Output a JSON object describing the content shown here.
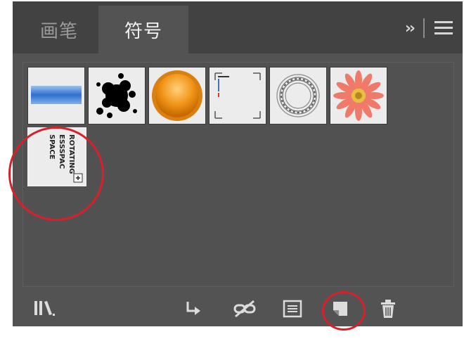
{
  "tabs": [
    {
      "label": "画笔",
      "active": false
    },
    {
      "label": "符号",
      "active": true
    }
  ],
  "header_icons": [
    "collapse-panel-icon",
    "panel-menu-icon"
  ],
  "symbols": [
    {
      "name": "blue-gradient-bar-symbol"
    },
    {
      "name": "ink-splat-symbol"
    },
    {
      "name": "orange-button-symbol"
    },
    {
      "name": "grid-corner-marks-symbol"
    },
    {
      "name": "ribbon-wreath-symbol"
    },
    {
      "name": "pink-flower-symbol"
    },
    {
      "name": "rotating-text-symbol",
      "lines": [
        "ROTATING",
        "ESSSPAC",
        "SPACE"
      ],
      "selected": true
    }
  ],
  "bottom_icons": [
    "symbol-libraries-icon",
    "place-symbol-instance-icon",
    "break-link-icon",
    "symbol-options-icon",
    "new-symbol-icon",
    "delete-symbol-icon"
  ],
  "colors": {
    "panel": "#535353",
    "tabbar": "#424242",
    "annotation": "#d8202a"
  }
}
